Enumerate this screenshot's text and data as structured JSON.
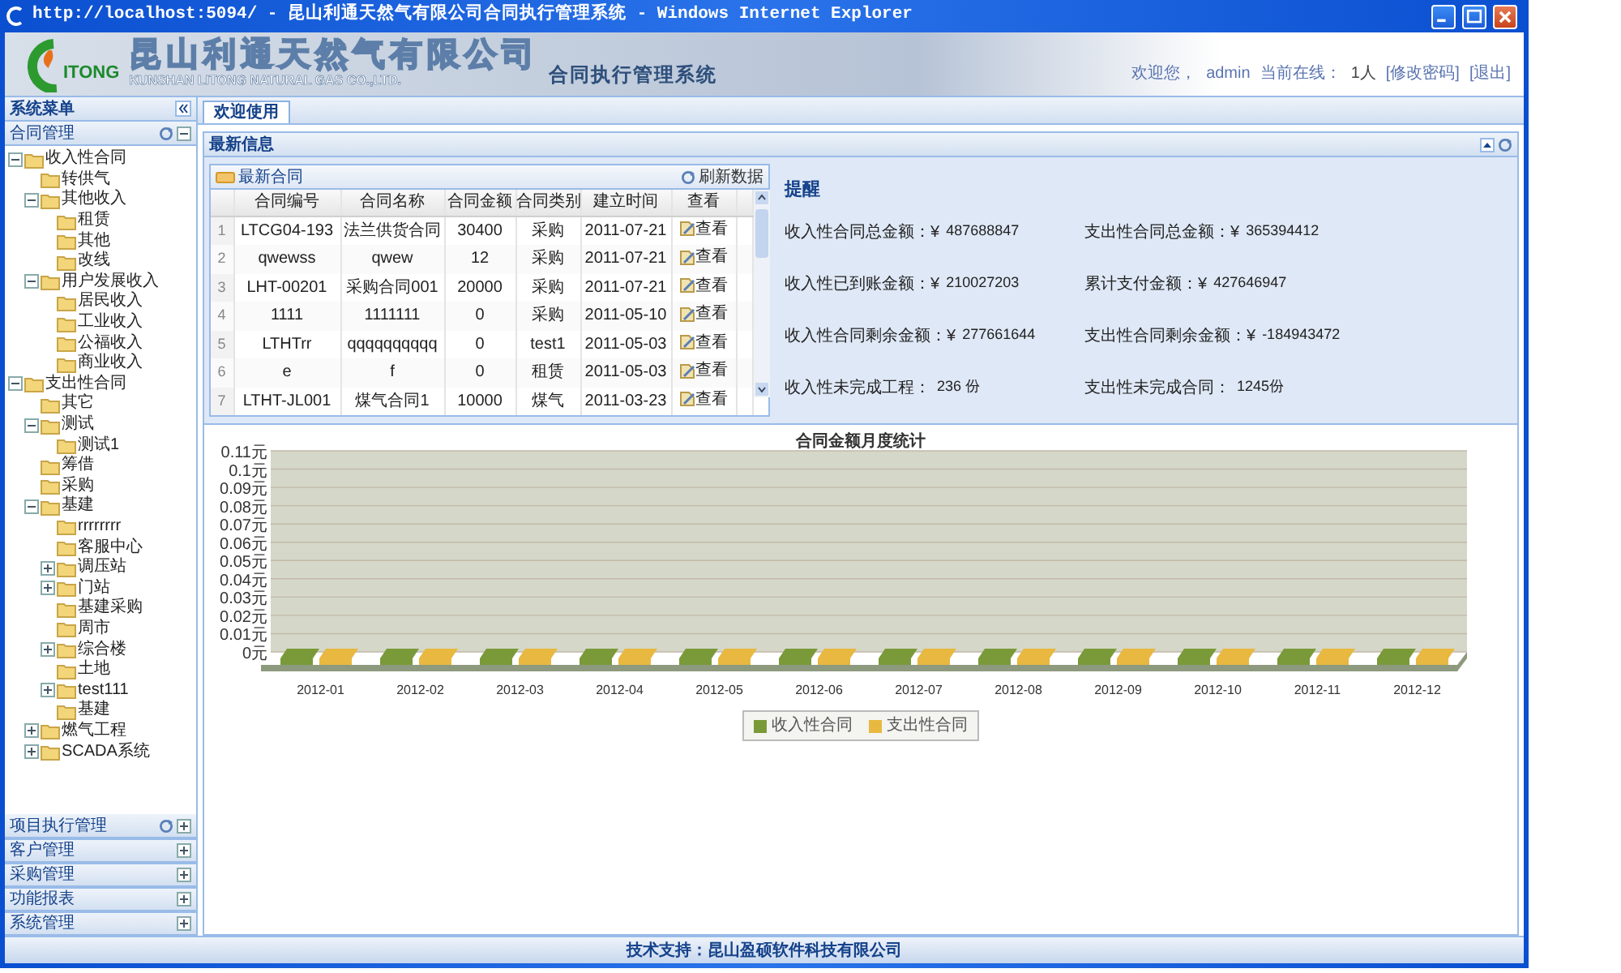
{
  "window": {
    "title": "http://localhost:5094/ - 昆山利通天然气有限公司合同执行管理系统 - Windows Internet Explorer"
  },
  "header": {
    "logo_mark": "ITONG",
    "company": "昆山利通天然气有限公司",
    "company_en": "KUNSHAN LITONG NATURAL GAS CO.,LTD.",
    "system": "合同执行管理系统",
    "welcome": "欢迎您，",
    "user": "admin",
    "online_label": "当前在线：",
    "online_count": "1人",
    "links": [
      "[修改密码]",
      "[退出]"
    ]
  },
  "sidebar": {
    "title": "系统菜单",
    "panels": [
      {
        "title": "合同管理",
        "expanded": true,
        "has_refresh": true,
        "tree": [
          {
            "label": "收入性合同",
            "expanded": true,
            "children": [
              {
                "label": "转供气"
              },
              {
                "label": "其他收入",
                "expanded": true,
                "children": [
                  {
                    "label": "租赁"
                  },
                  {
                    "label": "其他"
                  },
                  {
                    "label": "改线"
                  }
                ]
              },
              {
                "label": "用户发展收入",
                "expanded": true,
                "children": [
                  {
                    "label": "居民收入"
                  },
                  {
                    "label": "工业收入"
                  },
                  {
                    "label": "公福收入"
                  },
                  {
                    "label": "商业收入"
                  }
                ]
              }
            ]
          },
          {
            "label": "支出性合同",
            "expanded": true,
            "children": [
              {
                "label": "其它"
              },
              {
                "label": "测试",
                "expanded": true,
                "children": [
                  {
                    "label": "测试1"
                  }
                ]
              },
              {
                "label": "筹借"
              },
              {
                "label": "采购"
              },
              {
                "label": "基建",
                "expanded": true,
                "children": [
                  {
                    "label": "rrrrrrrr"
                  },
                  {
                    "label": "客服中心"
                  },
                  {
                    "label": "调压站",
                    "expanded": false
                  },
                  {
                    "label": "门站",
                    "expanded": false
                  },
                  {
                    "label": "基建采购"
                  },
                  {
                    "label": "周市"
                  },
                  {
                    "label": "综合楼",
                    "expanded": false
                  },
                  {
                    "label": "土地"
                  },
                  {
                    "label": "test111",
                    "expanded": false
                  },
                  {
                    "label": "基建"
                  }
                ]
              },
              {
                "label": "燃气工程",
                "expanded": false
              },
              {
                "label": "SCADA系统",
                "expanded": false
              }
            ]
          }
        ]
      },
      {
        "title": "项目执行管理",
        "expanded": false,
        "has_refresh": true
      },
      {
        "title": "客户管理",
        "expanded": false,
        "has_refresh": false
      },
      {
        "title": "采购管理",
        "expanded": false,
        "has_refresh": false
      },
      {
        "title": "功能报表",
        "expanded": false,
        "has_refresh": false
      },
      {
        "title": "系统管理",
        "expanded": false,
        "has_refresh": false
      }
    ]
  },
  "tabs": [
    {
      "label": "欢迎使用",
      "selected": true
    }
  ],
  "latest": {
    "title": "最新信息",
    "contracts": {
      "title": "最新合同",
      "refresh": "刷新数据",
      "columns": [
        "合同编号",
        "合同名称",
        "合同金额",
        "合同类别",
        "建立时间",
        "查看"
      ],
      "rows": [
        {
          "index": "1",
          "cells": [
            "LTCG04-193",
            "法兰供货合同",
            "30400",
            "采购",
            "2011-07-21"
          ],
          "action": "查看"
        },
        {
          "index": "2",
          "cells": [
            "qwewss",
            "qwew",
            "12",
            "采购",
            "2011-07-21"
          ],
          "action": "查看"
        },
        {
          "index": "3",
          "cells": [
            "LHT-00201",
            "采购合同001",
            "20000",
            "采购",
            "2011-07-21"
          ],
          "action": "查看"
        },
        {
          "index": "4",
          "cells": [
            "1111",
            "1111111",
            "0",
            "采购",
            "2011-05-10"
          ],
          "action": "查看"
        },
        {
          "index": "5",
          "cells": [
            "LTHTrr",
            "qqqqqqqqqq",
            "0",
            "test1",
            "2011-05-03"
          ],
          "action": "查看"
        },
        {
          "index": "6",
          "cells": [
            "e",
            "f",
            "0",
            "租赁",
            "2011-05-03"
          ],
          "action": "查看"
        },
        {
          "index": "7",
          "cells": [
            "LTHT-JL001",
            "煤气合同1",
            "10000",
            "煤气",
            "2011-03-23"
          ],
          "action": "查看"
        }
      ]
    },
    "reminder": {
      "title": "提醒",
      "stats": [
        {
          "label": "收入性合同总金额：¥",
          "value": "487688847"
        },
        {
          "label": "支出性合同总金额：¥",
          "value": "365394412"
        },
        {
          "label": "收入性已到账金额：¥",
          "value": "210027203"
        },
        {
          "label": "累计支付金额：¥",
          "value": "427646947"
        },
        {
          "label": "收入性合同剩余金额：¥",
          "value": "277661644"
        },
        {
          "label": "支出性合同剩余金额：¥",
          "value": "-184943472"
        },
        {
          "label": "收入性未完成工程：",
          "value": "236 份"
        },
        {
          "label": "支出性未完成合同：",
          "value": "1245份"
        }
      ]
    }
  },
  "chart": {
    "chart_data": {
      "type": "bar",
      "title": "合同金额月度统计",
      "categories": [
        "2012-01",
        "2012-02",
        "2012-03",
        "2012-04",
        "2012-05",
        "2012-06",
        "2012-07",
        "2012-08",
        "2012-09",
        "2012-10",
        "2012-11",
        "2012-12"
      ],
      "series": [
        {
          "name": "收入性合同",
          "color": "#7a9a3a",
          "values": [
            0,
            0,
            0,
            0,
            0,
            0,
            0,
            0,
            0,
            0,
            0,
            0
          ]
        },
        {
          "name": "支出性合同",
          "color": "#e8b840",
          "values": [
            0,
            0,
            0,
            0,
            0,
            0,
            0,
            0,
            0,
            0,
            0,
            0
          ]
        }
      ],
      "ylim": [
        0,
        0.11
      ],
      "grid": true,
      "legend": true,
      "yticks": [
        {
          "value": 0,
          "label": "0元"
        },
        {
          "value": 0.01,
          "label": "0.01元"
        },
        {
          "value": 0.02,
          "label": "0.02元"
        },
        {
          "value": 0.03,
          "label": "0.03元"
        },
        {
          "value": 0.04,
          "label": "0.04元"
        },
        {
          "value": 0.05,
          "label": "0.05元"
        },
        {
          "value": 0.06,
          "label": "0.06元"
        },
        {
          "value": 0.07,
          "label": "0.07元"
        },
        {
          "value": 0.08,
          "label": "0.08元"
        },
        {
          "value": 0.09,
          "label": "0.09元"
        },
        {
          "value": 0.1,
          "label": "0.1元"
        },
        {
          "value": 0.11,
          "label": "0.11元"
        }
      ]
    }
  },
  "footer": {
    "text": "技术支持：昆山盈硕软件科技有限公司"
  }
}
